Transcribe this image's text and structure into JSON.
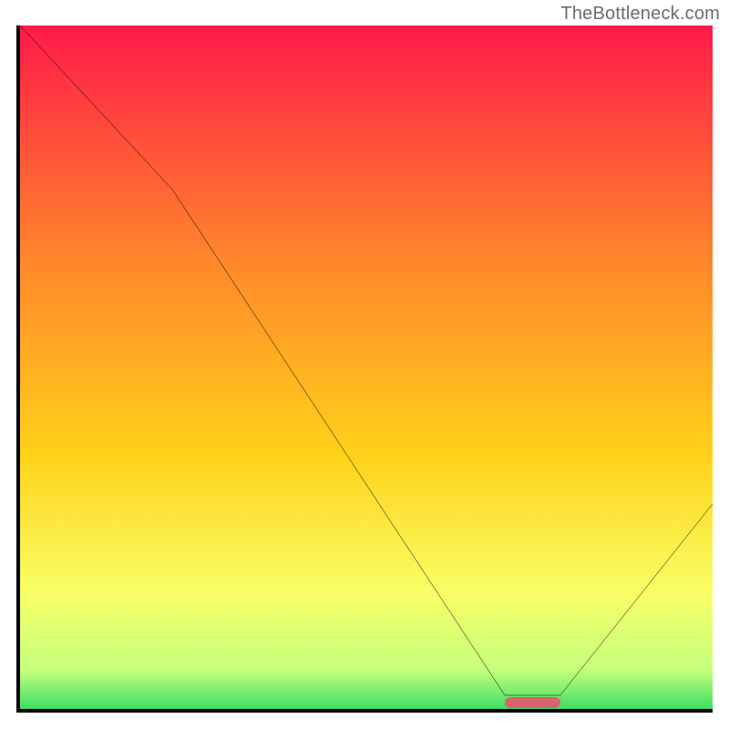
{
  "watermark": "TheBottleneck.com",
  "colors": {
    "top": "#ff1a49",
    "upper_mid": "#ff8a2a",
    "mid": "#ffd21a",
    "lower_mid": "#f8ff66",
    "near_bottom": "#c6ff7d",
    "bottom": "#1fd65f",
    "curve": "#000000",
    "indicator": "#d9636c",
    "axes": "#000000"
  },
  "chart_data": {
    "type": "line",
    "title": "",
    "xlabel": "",
    "ylabel": "",
    "xlim": [
      0,
      100
    ],
    "ylim": [
      0,
      100
    ],
    "x": [
      0,
      22,
      70,
      78,
      100
    ],
    "values": [
      100,
      76,
      2,
      2,
      30
    ],
    "annotations": [],
    "indicator_range_x": [
      70,
      78
    ],
    "indicator_y": 1,
    "background_gradient": [
      {
        "pos": 0.0,
        "color": "#ff1a49"
      },
      {
        "pos": 0.35,
        "color": "#ff8a2a"
      },
      {
        "pos": 0.62,
        "color": "#ffd21a"
      },
      {
        "pos": 0.82,
        "color": "#f8ff66"
      },
      {
        "pos": 0.93,
        "color": "#c6ff7d"
      },
      {
        "pos": 1.0,
        "color": "#1fd65f"
      }
    ]
  }
}
